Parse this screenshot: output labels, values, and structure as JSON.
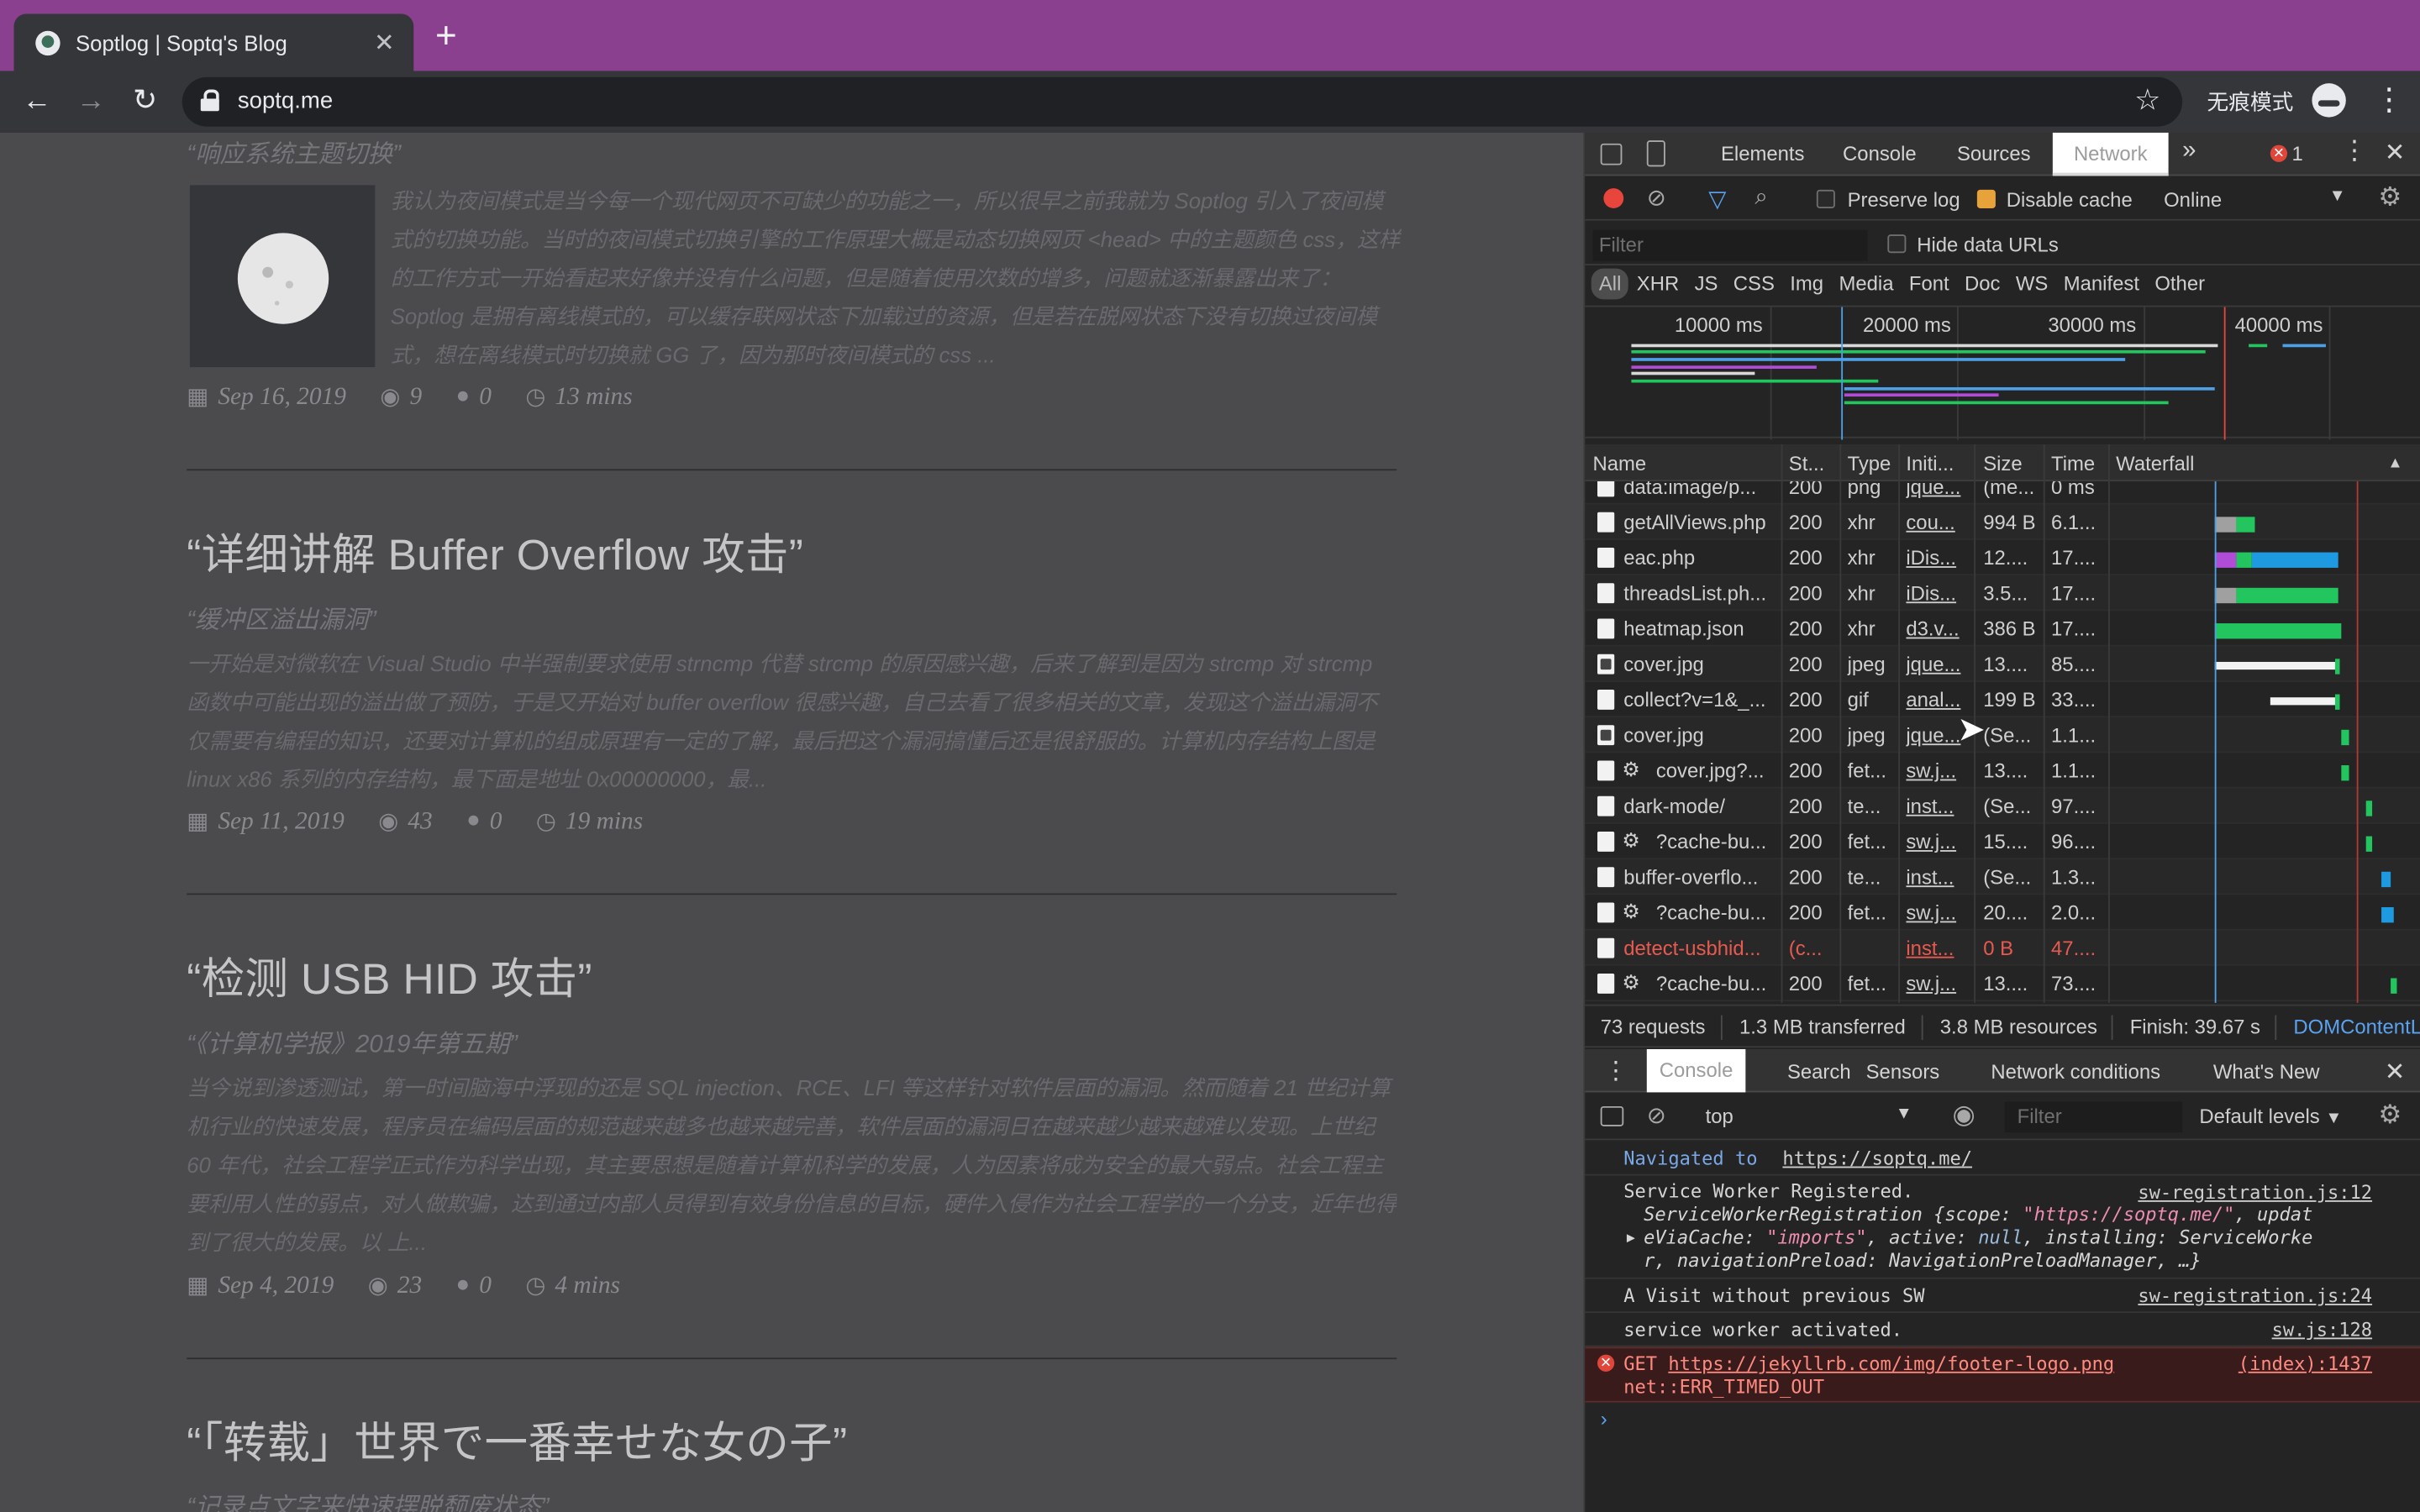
{
  "browser": {
    "tab_title": "Soptlog | Soptq's Blog",
    "tab_close": "✕",
    "new_tab": "+",
    "url": "soptq.me",
    "incognito_label": "无痕模式"
  },
  "page": {
    "top_subtitle": "“响应系统主题切换”",
    "post1": {
      "excerpt": "我认为夜间模式是当今每一个现代网页不可缺少的功能之一，所以很早之前我就为 Soptlog 引入了夜间模式的切换功能。当时的夜间模式切换引擎的工作原理大概是动态切换网页 <head> 中的主题颜色 css，这样的工作方式一开始看起来好像并没有什么问题，但是随着使用次数的增多，问题就逐渐暴露出来了：Soptlog 是拥有离线模式的，可以缓存联网状态下加载过的资源，但是若在脱网状态下没有切换过夜间模式，想在离线模式时切换就 GG 了，因为那时夜间模式的 css ...",
      "date": "Sep 16, 2019",
      "views": "9",
      "comments": "0",
      "read_time": "13 mins"
    },
    "post2": {
      "title": "“详细讲解 Buffer Overflow 攻击”",
      "subtitle": "“缓冲区溢出漏洞”",
      "excerpt": "一开始是对微软在 Visual Studio 中半强制要求使用 strncmp 代替 strcmp 的原因感兴趣，后来了解到是因为 strcmp 对 strcmp 函数中可能出现的溢出做了预防，于是又开始对 buffer overflow 很感兴趣，自己去看了很多相关的文章，发现这个溢出漏洞不仅需要有编程的知识，还要对计算机的组成原理有一定的了解，最后把这个漏洞搞懂后还是很舒服的。计算机内存结构上图是 linux x86 系列的内存结构，最下面是地址 0x00000000，最...",
      "date": "Sep 11, 2019",
      "views": "43",
      "comments": "0",
      "read_time": "19 mins"
    },
    "post3": {
      "title": "“检测 USB HID 攻击”",
      "subtitle": "“《计算机学报》2019年第五期”",
      "excerpt": "当今说到渗透测试，第一时间脑海中浮现的还是 SQL injection、RCE、LFI 等这样针对软件层面的漏洞。然而随着 21 世纪计算机行业的快速发展，程序员在编码层面的规范越来越多也越来越完善，软件层面的漏洞日在越来越少越来越难以发现。上世纪 60 年代，社会工程学正式作为科学出现，其主要思想是随着计算机科学的发展，人为因素将成为安全的最大弱点。社会工程主要利用人性的弱点，对人做欺骗，达到通过内部人员得到有效身份信息的目标，硬件入侵作为社会工程学的一个分支，近年也得到了很大的发展。以 上...",
      "date": "Sep 4, 2019",
      "views": "23",
      "comments": "0",
      "read_time": "4 mins"
    },
    "post4": {
      "title": "“「转载」世界で一番幸せな女の子”",
      "subtitle": "“记录点文字来快速摆脱颓废状态”"
    }
  },
  "devtools": {
    "tabs": [
      "Elements",
      "Console",
      "Sources",
      "Network"
    ],
    "more": "»",
    "error_count": "1",
    "preserve_log": "Preserve log",
    "disable_cache": "Disable cache",
    "throttle": "Online",
    "filter_placeholder": "Filter",
    "hide_data_urls": "Hide data URLs",
    "types": [
      "All",
      "XHR",
      "JS",
      "CSS",
      "Img",
      "Media",
      "Font",
      "Doc",
      "WS",
      "Manifest",
      "Other"
    ],
    "overview_ticks": [
      "10000 ms",
      "20000 ms",
      "30000 ms",
      "40000 ms"
    ],
    "columns": [
      "Name",
      "St...",
      "Type",
      "Initi...",
      "Size",
      "Time",
      "Waterfall"
    ],
    "rows": [
      {
        "name": "data:image/p...",
        "status": "200",
        "type": "png",
        "initiator": "jque...",
        "size": "(me...",
        "time": "0 ms"
      },
      {
        "name": "getAllViews.php",
        "status": "200",
        "type": "xhr",
        "initiator": "cou...",
        "size": "994 B",
        "time": "6.1..."
      },
      {
        "name": "eac.php",
        "status": "200",
        "type": "xhr",
        "initiator": "iDis...",
        "size": "12....",
        "time": "17...."
      },
      {
        "name": "threadsList.ph...",
        "status": "200",
        "type": "xhr",
        "initiator": "iDis...",
        "size": "3.5...",
        "time": "17...."
      },
      {
        "name": "heatmap.json",
        "status": "200",
        "type": "xhr",
        "initiator": "d3.v...",
        "size": "386 B",
        "time": "17...."
      },
      {
        "name": "cover.jpg",
        "status": "200",
        "type": "jpeg",
        "initiator": "jque...",
        "size": "13....",
        "time": "85...."
      },
      {
        "name": "collect?v=1&_...",
        "status": "200",
        "type": "gif",
        "initiator": "anal...",
        "size": "199 B",
        "time": "33...."
      },
      {
        "name": "cover.jpg",
        "status": "200",
        "type": "jpeg",
        "initiator": "jque...",
        "size": "(Se...",
        "time": "1.1..."
      },
      {
        "name": "cover.jpg?...",
        "status": "200",
        "type": "fet...",
        "initiator": "sw.j...",
        "size": "13....",
        "time": "1.1..."
      },
      {
        "name": "dark-mode/",
        "status": "200",
        "type": "te...",
        "initiator": "inst...",
        "size": "(Se...",
        "time": "97...."
      },
      {
        "name": "?cache-bu...",
        "status": "200",
        "type": "fet...",
        "initiator": "sw.j...",
        "size": "15....",
        "time": "96...."
      },
      {
        "name": "buffer-overflo...",
        "status": "200",
        "type": "te...",
        "initiator": "inst...",
        "size": "(Se...",
        "time": "1.3..."
      },
      {
        "name": "?cache-bu...",
        "status": "200",
        "type": "fet...",
        "initiator": "sw.j...",
        "size": "20....",
        "time": "2.0..."
      },
      {
        "name": "detect-usbhid...",
        "status": "(c...",
        "type": "",
        "initiator": "inst...",
        "size": "0 B",
        "time": "47...."
      },
      {
        "name": "?cache-bu...",
        "status": "200",
        "type": "fet...",
        "initiator": "sw.j...",
        "size": "13....",
        "time": "73...."
      }
    ],
    "summary": {
      "requests": "73 requests",
      "transferred": "1.3 MB transferred",
      "resources": "3.8 MB resources",
      "finish": "Finish: 39.67 s",
      "dcl": "DOMContentL"
    },
    "drawer_tabs": [
      "Console",
      "Search",
      "Sensors",
      "Network conditions",
      "What's New"
    ],
    "context": "top",
    "console_filter": "Filter",
    "levels": "Default levels",
    "console": {
      "nav_prefix": "Navigated to ",
      "nav_url": "https://soptq.me/",
      "sw_registered": "Service Worker Registered.",
      "sw_src": "sw-registration.js:12",
      "sw_obj_1a": "ServiceWorkerRegistration {scope: ",
      "sw_obj_1b": "\"https://soptq.me/\"",
      "sw_obj_1c": ", updat",
      "sw_obj_2a": "eViaCache: ",
      "sw_obj_2b": "\"imports\"",
      "sw_obj_2c": ", active: ",
      "sw_obj_2d": "null",
      "sw_obj_2e": ", installing: ServiceWorke",
      "sw_obj_3": "r, navigationPreload: NavigationPreloadManager, …}",
      "visit": "A Visit without previous SW",
      "visit_src": "sw-registration.js:24",
      "activated": "service worker activated.",
      "activated_src": "sw.js:128",
      "err_method": "GET ",
      "err_url": "https://jekyllrb.com/img/footer-logo.png",
      "err_src": "(index):1437",
      "err_msg": "net::ERR_TIMED_OUT"
    }
  }
}
